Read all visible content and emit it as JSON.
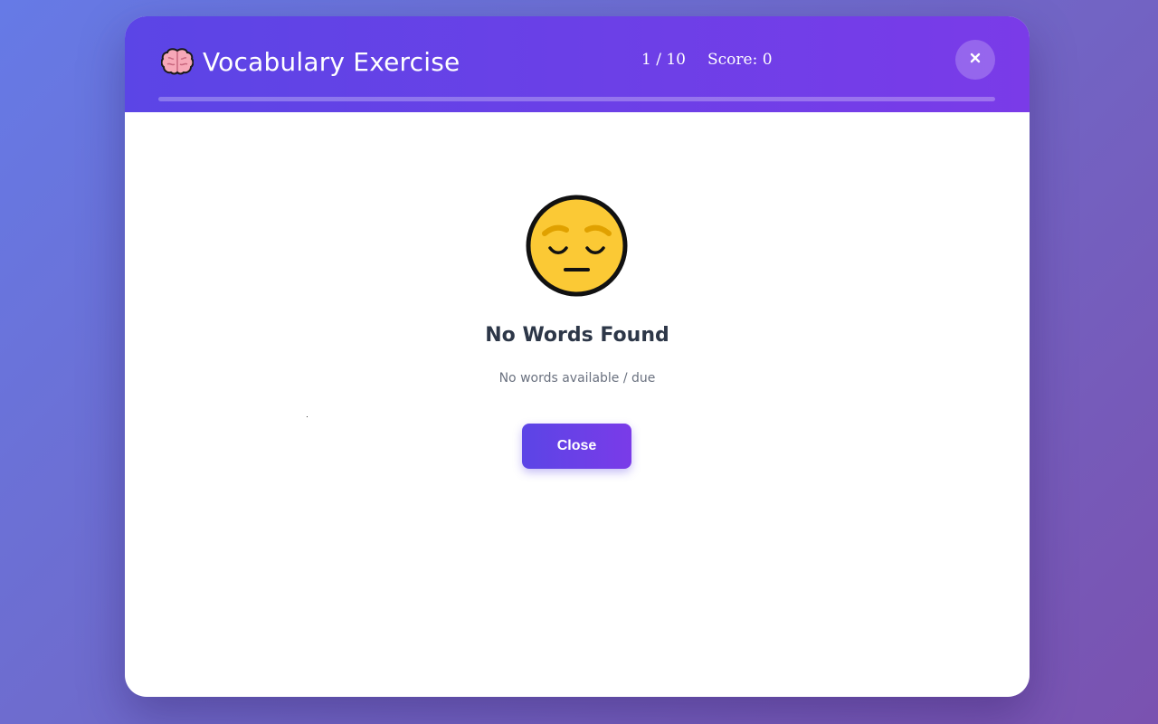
{
  "header": {
    "title": "Vocabulary Exercise",
    "title_icon": "brain-icon",
    "counter": "1 / 10",
    "score": "Score: 0",
    "close_icon": "close-icon",
    "progress_percent": 0
  },
  "empty_state": {
    "icon": "pensive-face-icon",
    "title": "No Words Found",
    "message": "No words available / due",
    "close_label": "Close"
  },
  "colors": {
    "accent_start": "#5b45e6",
    "accent_end": "#7a3be8",
    "heading": "#2d3748",
    "muted": "#6b7280"
  }
}
